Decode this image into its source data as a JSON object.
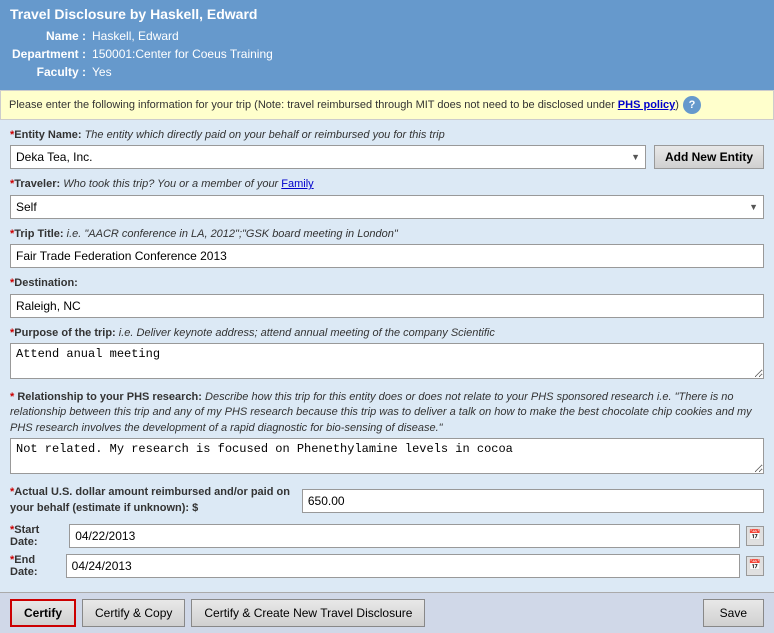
{
  "header": {
    "title": "Travel Disclosure by Haskell, Edward",
    "name_label": "Name :",
    "name_value": "Haskell, Edward",
    "dept_label": "Department :",
    "dept_value": "150001:Center for Coeus Training",
    "faculty_label": "Faculty :",
    "faculty_value": "Yes"
  },
  "notice": {
    "text": "Please enter the following information for your trip (Note: travel reimbursed through MIT does not need to be disclosed under ",
    "link_text": "PHS policy",
    "text_end": ")",
    "help_icon": "?"
  },
  "form": {
    "entity_label_required": "*",
    "entity_label_bold": "Entity Name:",
    "entity_label_italic": " The entity which directly paid on your behalf or reimbursed you for this trip",
    "entity_value": "Deka Tea, Inc.",
    "entity_options": [
      "Deka Tea, Inc."
    ],
    "add_entity_label": "Add New Entity",
    "traveler_label_required": "*",
    "traveler_label_bold": "Traveler:",
    "traveler_label_italic": " Who took this trip? You or a member of your ",
    "traveler_link": "Family",
    "traveler_value": "Self",
    "traveler_options": [
      "Self"
    ],
    "trip_label_required": "*",
    "trip_label_bold": "Trip Title:",
    "trip_label_italic": " i.e. \"AACR conference in LA, 2012\";\"GSK board meeting in London\"",
    "trip_value": "Fair Trade Federation Conference 2013",
    "destination_label_required": "*",
    "destination_label_bold": "Destination:",
    "destination_value": "Raleigh, NC",
    "purpose_label_required": "*",
    "purpose_label_bold": "Purpose of the trip:",
    "purpose_label_italic": " i.e. Deliver keynote address; attend annual meeting of the company Scientific",
    "purpose_value": "Attend anual meeting",
    "relationship_label_required": "* ",
    "relationship_label_bold": "Relationship to your PHS research:",
    "relationship_label_desc": " Describe how this trip for this entity does or does not relate to your PHS sponsored research i.e. \"There is no relationship between this trip and any of my PHS research because this trip was to deliver a talk on how to make the best chocolate chip cookies and my PHS research involves the development of a rapid diagnostic for bio-sensing of disease.\"",
    "relationship_value": "Not related. My research is focused on Phenethylamine levels in cocoa",
    "amount_label_required": "*",
    "amount_label_bold": "Actual U.S. dollar amount reimbursed and/or paid on your behalf (estimate if unknown): $",
    "amount_value": "650.00",
    "start_label_required": "*",
    "start_label_bold": "Start Date:",
    "start_value": "04/22/2013",
    "end_label_required": "*",
    "end_label_bold": "End Date:",
    "end_value": "04/24/2013"
  },
  "footer": {
    "certify_label": "Certify",
    "certify_copy_label": "Certify & Copy",
    "certify_create_label": "Certify & Create  New Travel Disclosure",
    "save_label": "Save"
  }
}
